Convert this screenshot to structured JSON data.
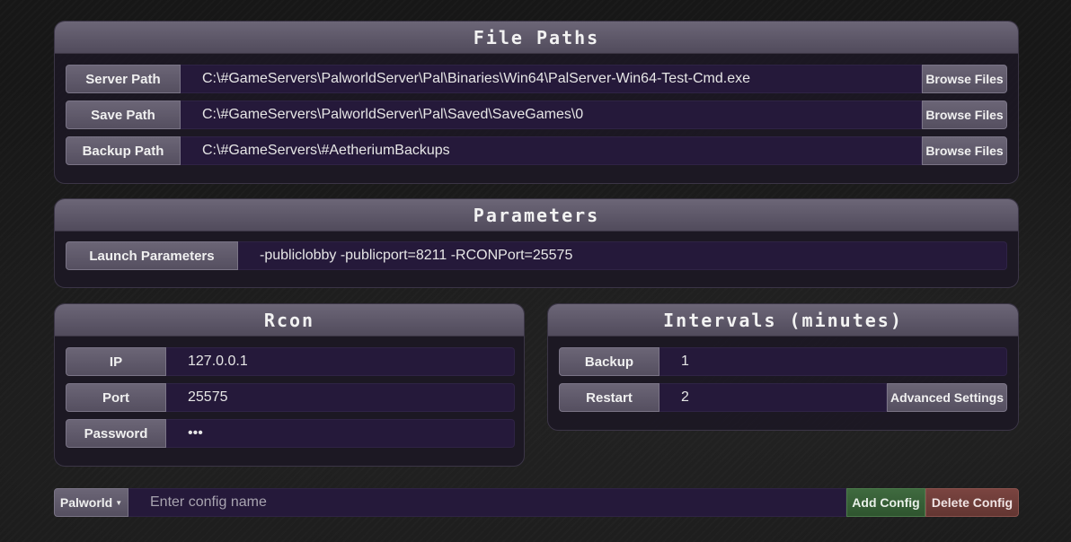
{
  "file_paths": {
    "title": "File Paths",
    "server_path": {
      "label": "Server Path",
      "value": "C:\\#GameServers\\PalworldServer\\Pal\\Binaries\\Win64\\PalServer-Win64-Test-Cmd.exe",
      "button": "Browse Files"
    },
    "save_path": {
      "label": "Save Path",
      "value": "C:\\#GameServers\\PalworldServer\\Pal\\Saved\\SaveGames\\0",
      "button": "Browse Files"
    },
    "backup_path": {
      "label": "Backup Path",
      "value": "C:\\#GameServers\\#AetheriumBackups",
      "button": "Browse Files"
    }
  },
  "parameters": {
    "title": "Parameters",
    "launch": {
      "label": "Launch Parameters",
      "value": "-publiclobby -publicport=8211 -RCONPort=25575"
    }
  },
  "rcon": {
    "title": "Rcon",
    "ip": {
      "label": "IP",
      "value": "127.0.0.1"
    },
    "port": {
      "label": "Port",
      "value": "25575"
    },
    "password": {
      "label": "Password",
      "value": "•••"
    }
  },
  "intervals": {
    "title": "Intervals (minutes)",
    "backup": {
      "label": "Backup",
      "value": "1"
    },
    "restart": {
      "label": "Restart",
      "value": "2",
      "button": "Advanced Settings"
    }
  },
  "config_bar": {
    "game": "Palworld",
    "placeholder": "Enter config name",
    "add_label": "Add Config",
    "delete_label": "Delete Config"
  },
  "colors": {
    "field_bg": "#25193a",
    "header_bg": "#5e5869",
    "add_green": "#3a623a",
    "delete_red": "#6e3c38"
  },
  "icons": {
    "dropdown": "caret-down-icon"
  }
}
